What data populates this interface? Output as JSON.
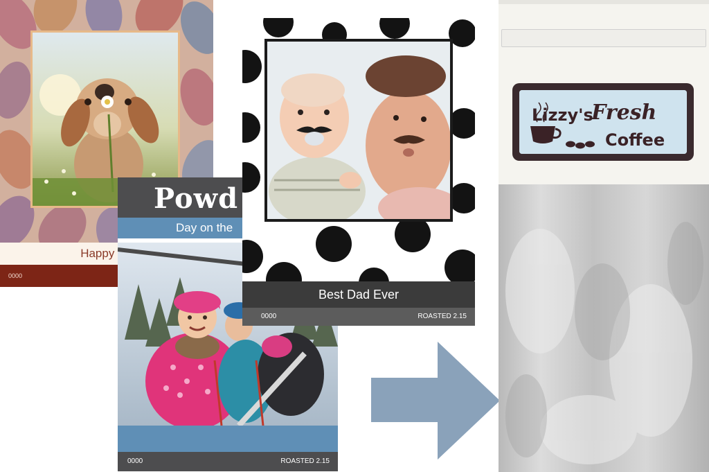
{
  "cards": {
    "card1": {
      "caption": "Happy Do",
      "footer_code": "0000"
    },
    "card2": {
      "title": "Powd",
      "subtitle": "Day on the",
      "footer_code": "0000",
      "footer_roast": "ROASTED 2.15"
    },
    "card3": {
      "caption": "Best Dad Ever",
      "footer_code": "0000",
      "footer_roast": "ROASTED 2.15"
    }
  },
  "arrow": {
    "icon": "right-arrow-icon",
    "color": "#8aa2ba"
  },
  "bag": {
    "brand_line1": "Lizzy's",
    "brand_line2": "Fresh",
    "brand_line3": "Coffee",
    "label_bg": "#cfe3ee",
    "label_frame": "#3a2a2e"
  },
  "colors": {
    "card1_footer": "#7d2516",
    "card2_accent": "#5f8fb6",
    "card2_dark": "#4d4d4f",
    "card3_dark": "#3b3b3b"
  }
}
